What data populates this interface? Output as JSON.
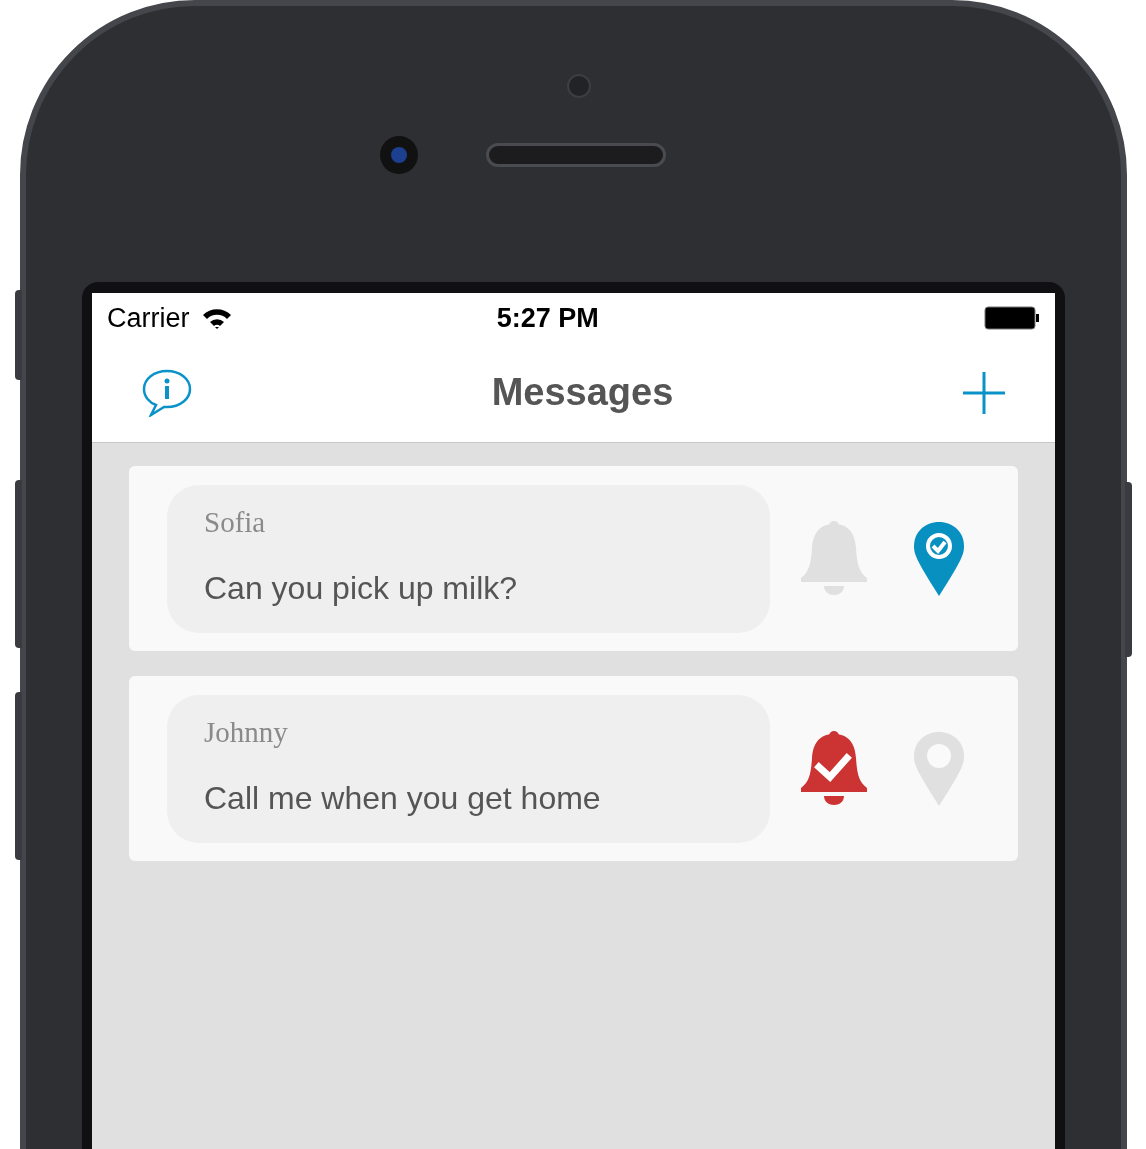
{
  "status_bar": {
    "carrier": "Carrier",
    "time": "5:27 PM"
  },
  "nav": {
    "title": "Messages"
  },
  "messages": [
    {
      "sender": "Sofia",
      "text": "Can you pick up milk?",
      "reminder_on": false,
      "location_on": true
    },
    {
      "sender": "Johnny",
      "text": "Call me when you get home",
      "reminder_on": true,
      "location_on": false
    }
  ]
}
